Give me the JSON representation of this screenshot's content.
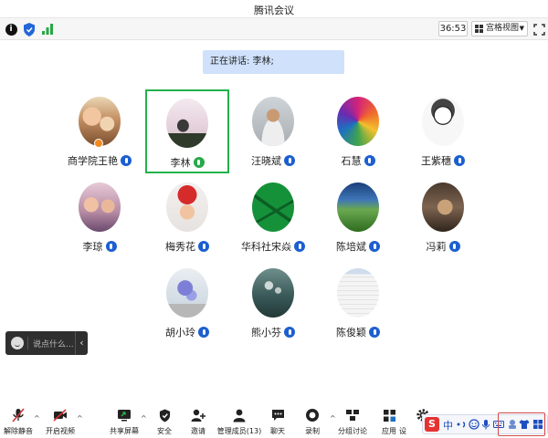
{
  "window": {
    "title": "腾讯会议"
  },
  "toolbar": {
    "timer": "36:53",
    "view_mode": "宫格视图"
  },
  "banner": {
    "speaking": "正在讲话: 李林;"
  },
  "participants": [
    {
      "name": "商学院王艳"
    },
    {
      "name": "李林"
    },
    {
      "name": "汪晓斌"
    },
    {
      "name": "石慧"
    },
    {
      "name": "王紫穗"
    },
    {
      "name": "李琼"
    },
    {
      "name": "梅秀花"
    },
    {
      "name": "华科社宋焱"
    },
    {
      "name": "陈培斌"
    },
    {
      "name": "冯莉"
    },
    {
      "name": "胡小玲"
    },
    {
      "name": "熊小芬"
    },
    {
      "name": "陈俊颖"
    }
  ],
  "comment": {
    "placeholder": "说点什么..."
  },
  "bottombar": {
    "unmute": "解除静音",
    "video": "开启视频",
    "share": "共享屏幕",
    "security": "安全",
    "invite": "邀请",
    "members": "管理成员(13)",
    "chat": "聊天",
    "record": "录制",
    "breakout": "分组讨论",
    "apps": "应用",
    "settings": "设"
  },
  "ime": {
    "lang": "中"
  }
}
